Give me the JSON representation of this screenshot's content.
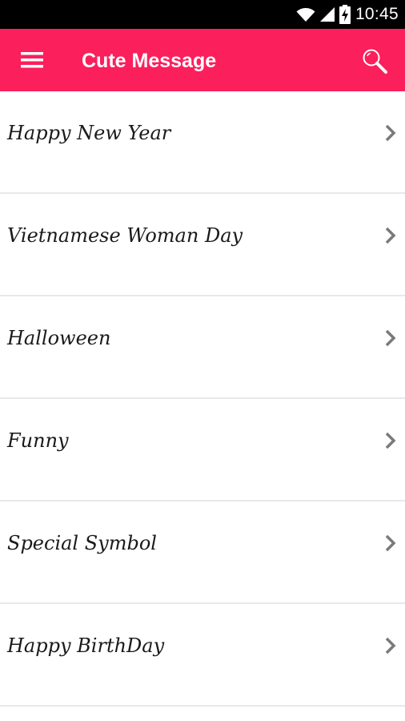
{
  "status_bar": {
    "time": "10:45",
    "icons": [
      "wifi-icon",
      "signal-icon",
      "battery-charging-icon"
    ]
  },
  "app_bar": {
    "title": "Cute Message",
    "menu_icon": "hamburger-menu-icon",
    "search_icon": "search-icon",
    "color": "#fb1f5b"
  },
  "categories": [
    {
      "label": "Happy New Year"
    },
    {
      "label": "Vietnamese Woman Day"
    },
    {
      "label": "Halloween"
    },
    {
      "label": "Funny"
    },
    {
      "label": "Special Symbol"
    },
    {
      "label": "Happy BirthDay"
    }
  ]
}
